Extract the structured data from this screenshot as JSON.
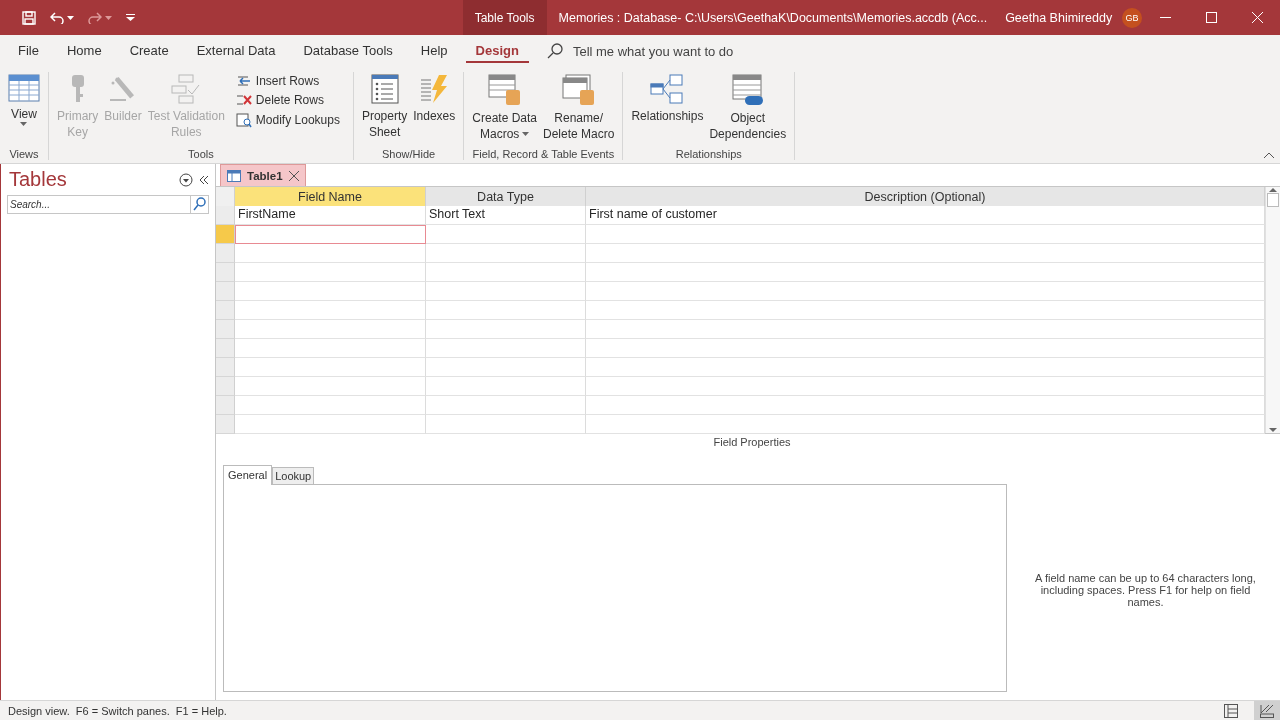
{
  "title_bar": {
    "context_tab": "Table Tools",
    "title": "Memories : Database- C:\\Users\\GeethaK\\Documents\\Memories.accdb (Acc...",
    "user": "Geetha Bhimireddy",
    "avatar": "GB"
  },
  "ribbon_tabs": [
    {
      "label": "File",
      "selected": false
    },
    {
      "label": "Home",
      "selected": false
    },
    {
      "label": "Create",
      "selected": false
    },
    {
      "label": "External Data",
      "selected": false
    },
    {
      "label": "Database Tools",
      "selected": false
    },
    {
      "label": "Help",
      "selected": false
    },
    {
      "label": "Design",
      "selected": true
    }
  ],
  "tell_me": {
    "placeholder": "Tell me what you want to do"
  },
  "ribbon_groups": [
    {
      "label": "Views",
      "buttons": [
        {
          "kind": "large",
          "lines": [
            "View"
          ],
          "disabled": false,
          "dropdown": true
        }
      ]
    },
    {
      "label": "Tools",
      "buttons": [
        {
          "kind": "large",
          "lines": [
            "Primary",
            "Key"
          ],
          "disabled": true,
          "dropdown": false
        },
        {
          "kind": "large",
          "lines": [
            "Builder"
          ],
          "disabled": true,
          "dropdown": false
        },
        {
          "kind": "large",
          "lines": [
            "Test Validation",
            "Rules"
          ],
          "disabled": true,
          "dropdown": false
        },
        {
          "kind": "small",
          "lines": [
            "Insert Rows"
          ],
          "disabled": false,
          "dropdown": false
        },
        {
          "kind": "small",
          "lines": [
            "Delete Rows"
          ],
          "disabled": false,
          "dropdown": false
        },
        {
          "kind": "small",
          "lines": [
            "Modify Lookups"
          ],
          "disabled": false,
          "dropdown": false
        }
      ]
    },
    {
      "label": "Show/Hide",
      "buttons": [
        {
          "kind": "large",
          "lines": [
            "Property",
            "Sheet"
          ],
          "disabled": false,
          "dropdown": false
        },
        {
          "kind": "large",
          "lines": [
            "Indexes"
          ],
          "disabled": false,
          "dropdown": false
        }
      ]
    },
    {
      "label": "Field, Record & Table Events",
      "buttons": [
        {
          "kind": "large",
          "lines": [
            "Create Data",
            "Macros"
          ],
          "disabled": false,
          "dropdown": true
        },
        {
          "kind": "large",
          "lines": [
            "Rename/",
            "Delete Macro"
          ],
          "disabled": false,
          "dropdown": false
        }
      ]
    },
    {
      "label": "Relationships",
      "buttons": [
        {
          "kind": "large",
          "lines": [
            "Relationships"
          ],
          "disabled": false,
          "dropdown": false
        },
        {
          "kind": "large",
          "lines": [
            "Object",
            "Dependencies"
          ],
          "disabled": false,
          "dropdown": false
        }
      ]
    }
  ],
  "nav_pane": {
    "title": "Tables",
    "search": {
      "placeholder": "Search..."
    }
  },
  "document_tab": {
    "label": "Table1",
    "selected": true
  },
  "grid": {
    "columns": [
      {
        "label": "Field Name",
        "selected": true
      },
      {
        "label": "Data Type",
        "selected": false
      },
      {
        "label": "Description (Optional)",
        "selected": false
      }
    ],
    "rows": [
      {
        "cells": [
          "FirstName",
          "Short Text",
          "First name of customer"
        ]
      }
    ],
    "new_row": {
      "current": true
    }
  },
  "field_properties": {
    "title": "Field Properties",
    "tabs": [
      {
        "label": "General",
        "selected": true
      },
      {
        "label": "Lookup",
        "selected": false
      }
    ],
    "help": "A field name can be up to 64 characters long, including spaces. Press F1 for help on field names."
  },
  "status_bar": {
    "text": "Design view.  F6 = Switch panes.  F1 = Help.",
    "views": [
      {
        "selected": false
      },
      {
        "selected": true
      }
    ]
  }
}
